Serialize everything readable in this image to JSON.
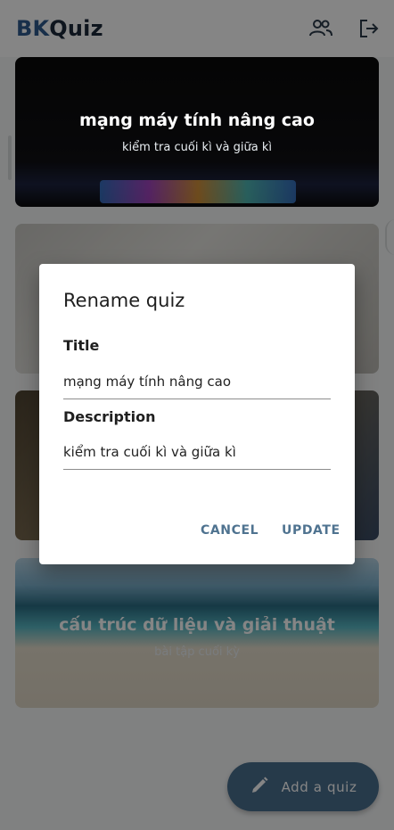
{
  "app": {
    "logo_bk": "BK",
    "logo_quiz": "Quiz",
    "icons": [
      "people-icon",
      "logout-icon"
    ]
  },
  "quizzes": [
    {
      "title": "mạng máy tính nâng cao",
      "subtitle": "kiểm tra cuối kì và giữa kì"
    },
    {
      "title": "",
      "subtitle": ""
    },
    {
      "title": "",
      "subtitle": ""
    },
    {
      "title": "cấu trúc dữ liệu và giải thuật",
      "subtitle": "bài tập cuối kỳ"
    }
  ],
  "fab": {
    "label": "Add a quiz",
    "icon": "pencil-icon"
  },
  "dialog": {
    "title": "Rename quiz",
    "title_label": "Title",
    "title_value": "mạng máy tính nâng cao",
    "description_label": "Description",
    "description_value": "kiểm tra cuối kì và giữa kì",
    "cancel_label": "CANCEL",
    "update_label": "UPDATE"
  },
  "colors": {
    "accent": "#4f7390",
    "brand": "#2f5b8f"
  }
}
